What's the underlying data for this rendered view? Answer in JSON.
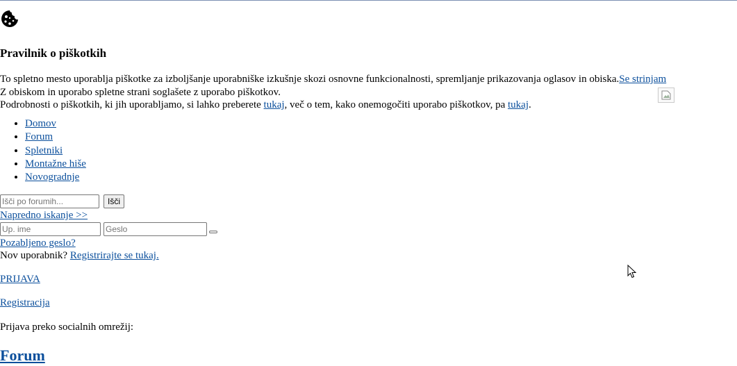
{
  "cookie_bar": {
    "icon": "cookie-icon",
    "title": "Pravilnik o piškotkih",
    "line1_text": "To spletno mesto uporablja piškotke za izboljšanje uporabniške izkušnje skozi osnovne funkcionalnosti, spremljanje prikazovanja oglasov in obiska.",
    "agree_link": "Se strinjam",
    "line2_text": "Z obiskom in uporabo spletne strani soglašete z uporabo piškotkov.",
    "line3_prefix": "Podrobnosti o piškotkih, ki jih uporabljamo, si lahko preberete ",
    "line3_link1": "tukaj",
    "line3_middle": ", več o tem, kako onemogočiti uporabo piškotkov, pa ",
    "line3_link2": "tukaj",
    "line3_suffix": "."
  },
  "nav": {
    "items": [
      {
        "label": "Domov"
      },
      {
        "label": "Forum"
      },
      {
        "label": "Spletniki"
      },
      {
        "label": "Montažne hiše"
      },
      {
        "label": "Novogradnje"
      }
    ]
  },
  "search": {
    "placeholder": "Išči po forumih...",
    "button_label": "Išči",
    "advanced_link": "Napredno iskanje >>"
  },
  "login": {
    "username_placeholder": "Up. ime",
    "password_placeholder": "Geslo",
    "forgot_link": "Pozabljeno geslo?",
    "new_user_text": "Nov uporabnik? ",
    "register_here_link": "Registrirajte se tukaj.",
    "prijava_link": "PRIJAVA",
    "registracija_link": "Registracija",
    "social_text": "Prijava preko socialnih omrežij:"
  },
  "main": {
    "forum_heading": "Forum"
  }
}
